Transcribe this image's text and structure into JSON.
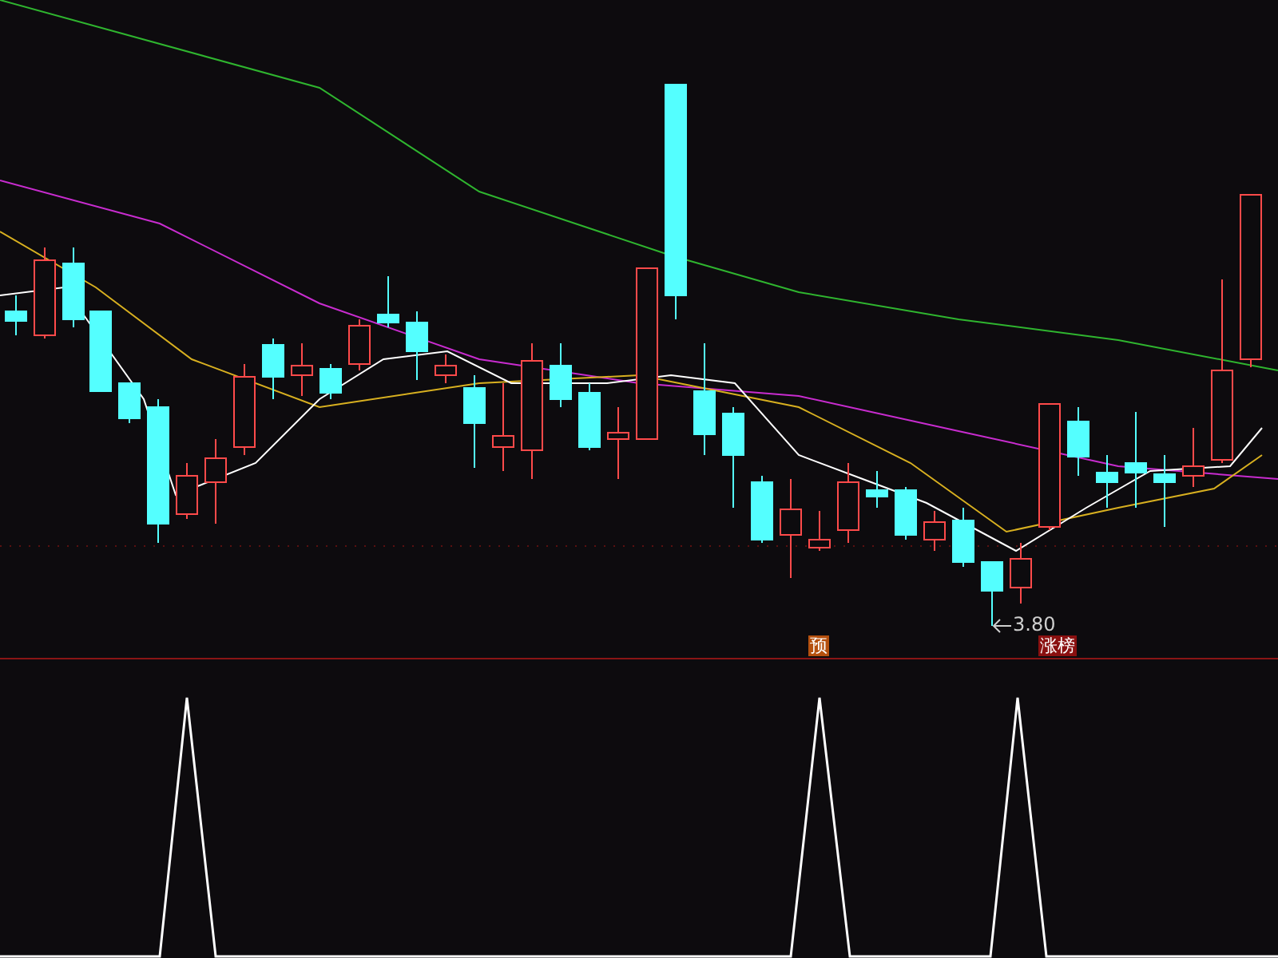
{
  "price_chart": {
    "low_marker": "3.80",
    "signals": [
      {
        "label": "预",
        "kind": "forecast"
      },
      {
        "label": "涨榜",
        "kind": "limit_up"
      }
    ]
  }
}
